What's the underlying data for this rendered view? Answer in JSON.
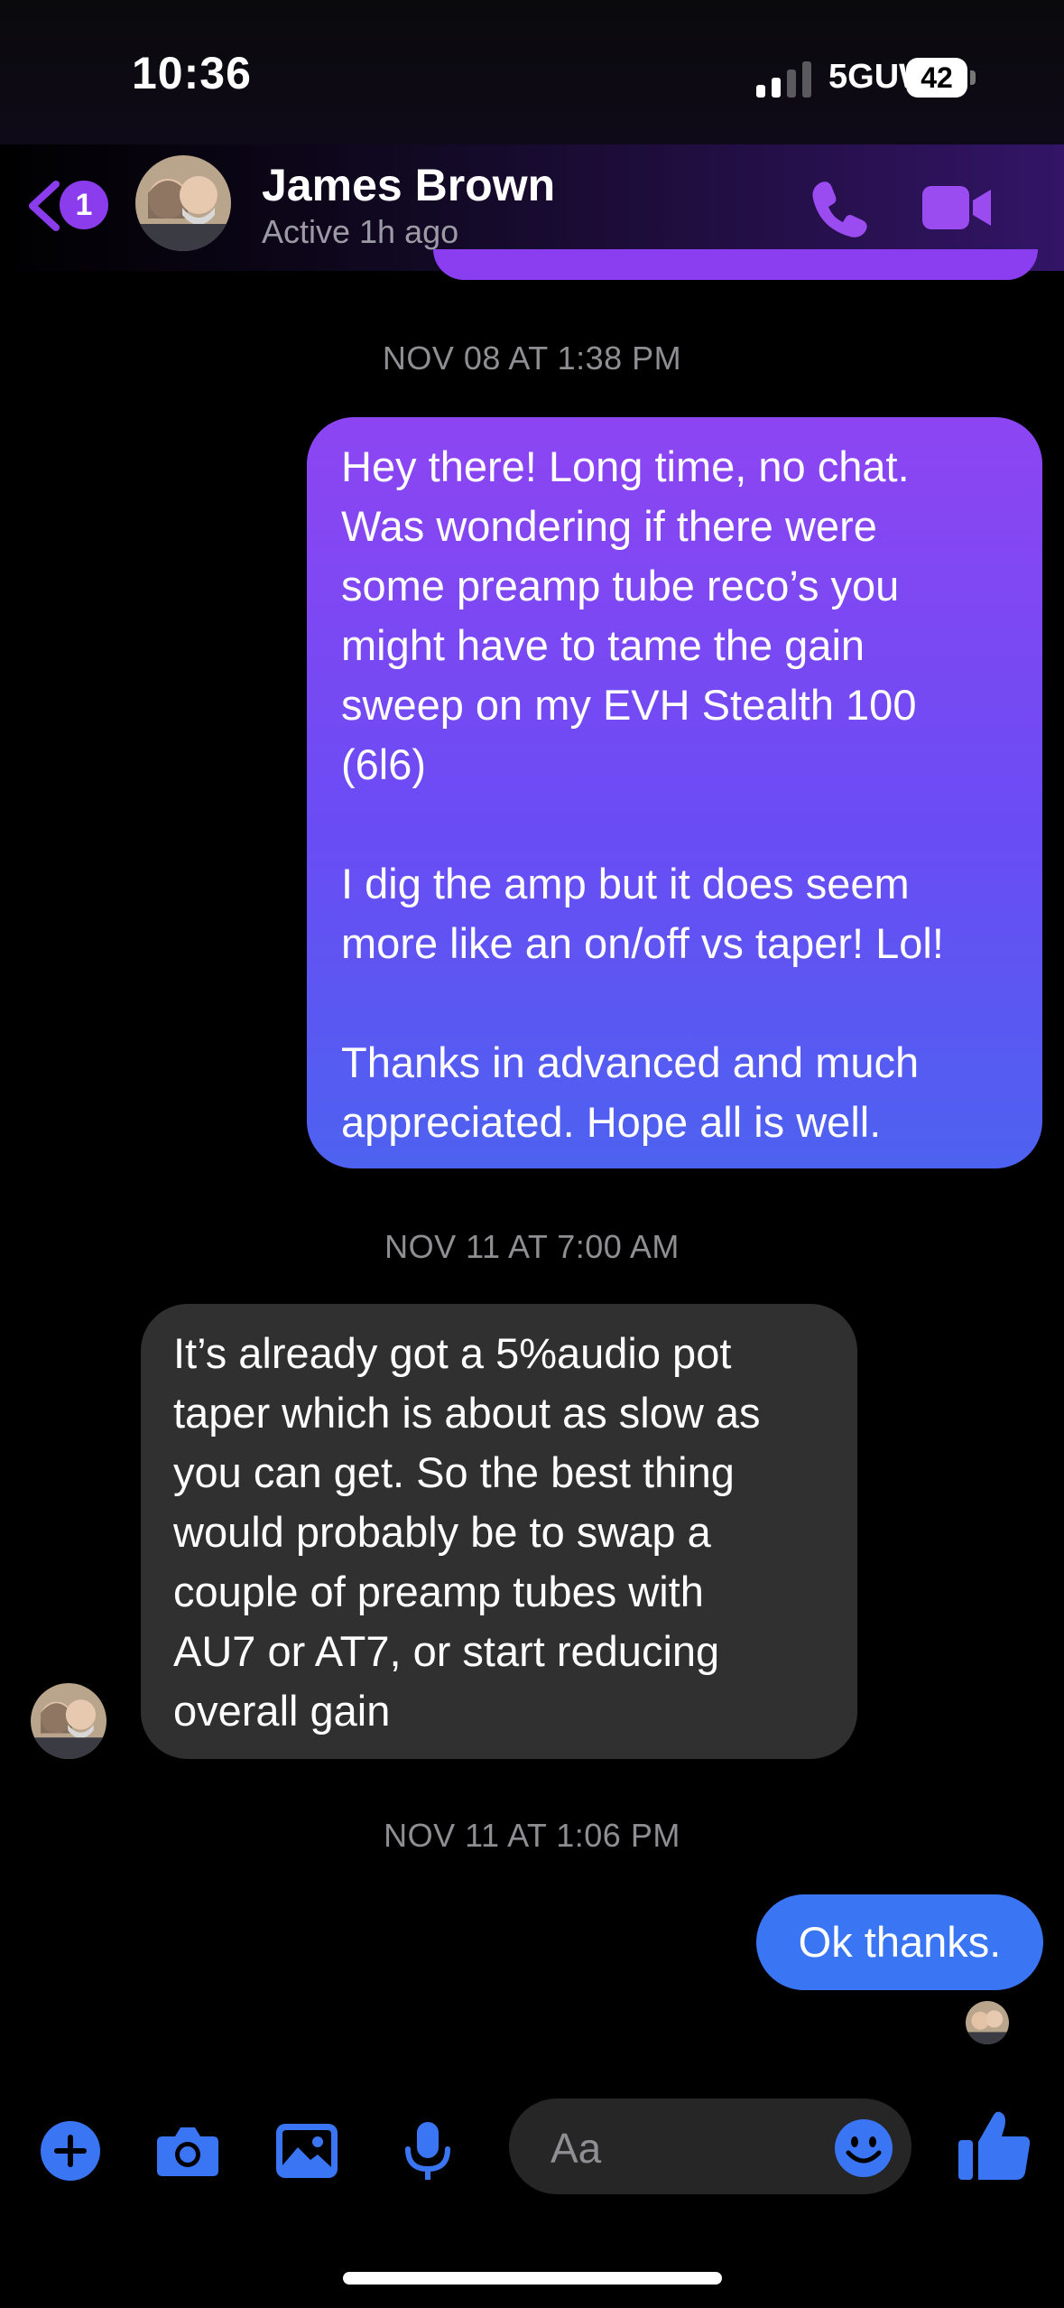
{
  "status_bar": {
    "time": "10:36",
    "network": "5GUW",
    "battery": "42"
  },
  "header": {
    "back_badge": "1",
    "contact_name": "James Brown",
    "contact_status": "Active 1h ago"
  },
  "messages": [
    {
      "timestamp": "NOV 08 AT 1:38 PM"
    },
    {
      "direction": "outgoing",
      "text": "Hey there! Long time, no chat.\nWas wondering if there were\nsome preamp tube reco’s you\nmight have to tame the gain\nsweep on my EVH Stealth 100\n(6l6)\n\nI dig the amp but it does seem\nmore like an on/off vs taper! Lol!\n\nThanks in advanced and much\nappreciated. Hope all is well."
    },
    {
      "timestamp": "NOV 11 AT 7:00 AM"
    },
    {
      "direction": "incoming",
      "text": "It’s already got a 5%audio pot\ntaper which is about as slow as\nyou can get. So the best thing\nwould probably be to swap a\ncouple of preamp tubes with\nAU7 or AT7, or start reducing\noverall gain"
    },
    {
      "timestamp": "NOV 11 AT 1:06 PM"
    },
    {
      "direction": "outgoing",
      "text": "Ok thanks."
    }
  ],
  "composer": {
    "placeholder": "Aa"
  },
  "colors": {
    "accent_purple": "#8b3dee",
    "accent_blue": "#3a76f4",
    "incoming_bubble": "#303030"
  },
  "icons": [
    "chevron-left-icon",
    "phone-icon",
    "video-icon",
    "plus-icon",
    "camera-icon",
    "image-icon",
    "microphone-icon",
    "emoji-icon",
    "thumbs-up-icon"
  ]
}
